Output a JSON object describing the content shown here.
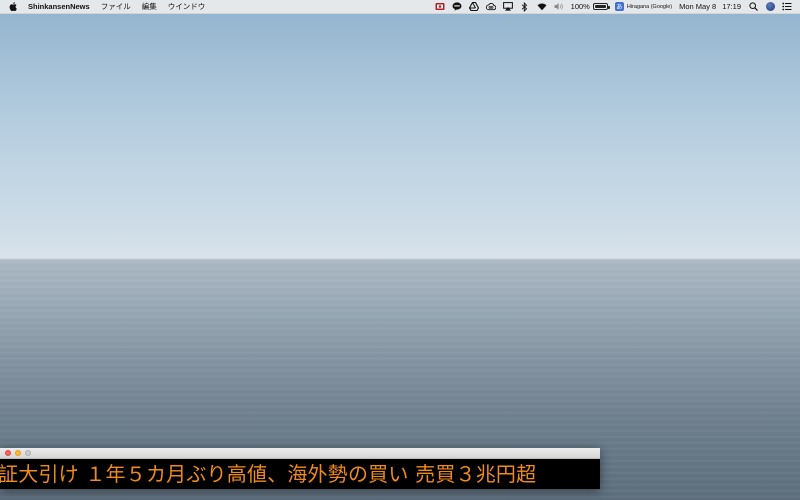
{
  "menubar": {
    "app_name": "ShinkansenNews",
    "menus": [
      "ファイル",
      "編集",
      "ウインドウ"
    ],
    "tray": {
      "icons": [
        "photo-booth-icon",
        "line-icon",
        "google-drive-icon",
        "creative-cloud-icon",
        "airplay-icon",
        "bluetooth-icon",
        "wifi-icon",
        "volume-icon"
      ],
      "battery_label": "100%",
      "battery_level": 1.0,
      "input_source_badge": "あ",
      "input_source_label": "Hiragana (Google)",
      "date": "Mon May 8",
      "time": "17:19"
    }
  },
  "ticker": {
    "headline": "証大引け １年５カ月ぶり高値、海外勢の買い 売買３兆円超",
    "text_color": "#f08a1c"
  }
}
